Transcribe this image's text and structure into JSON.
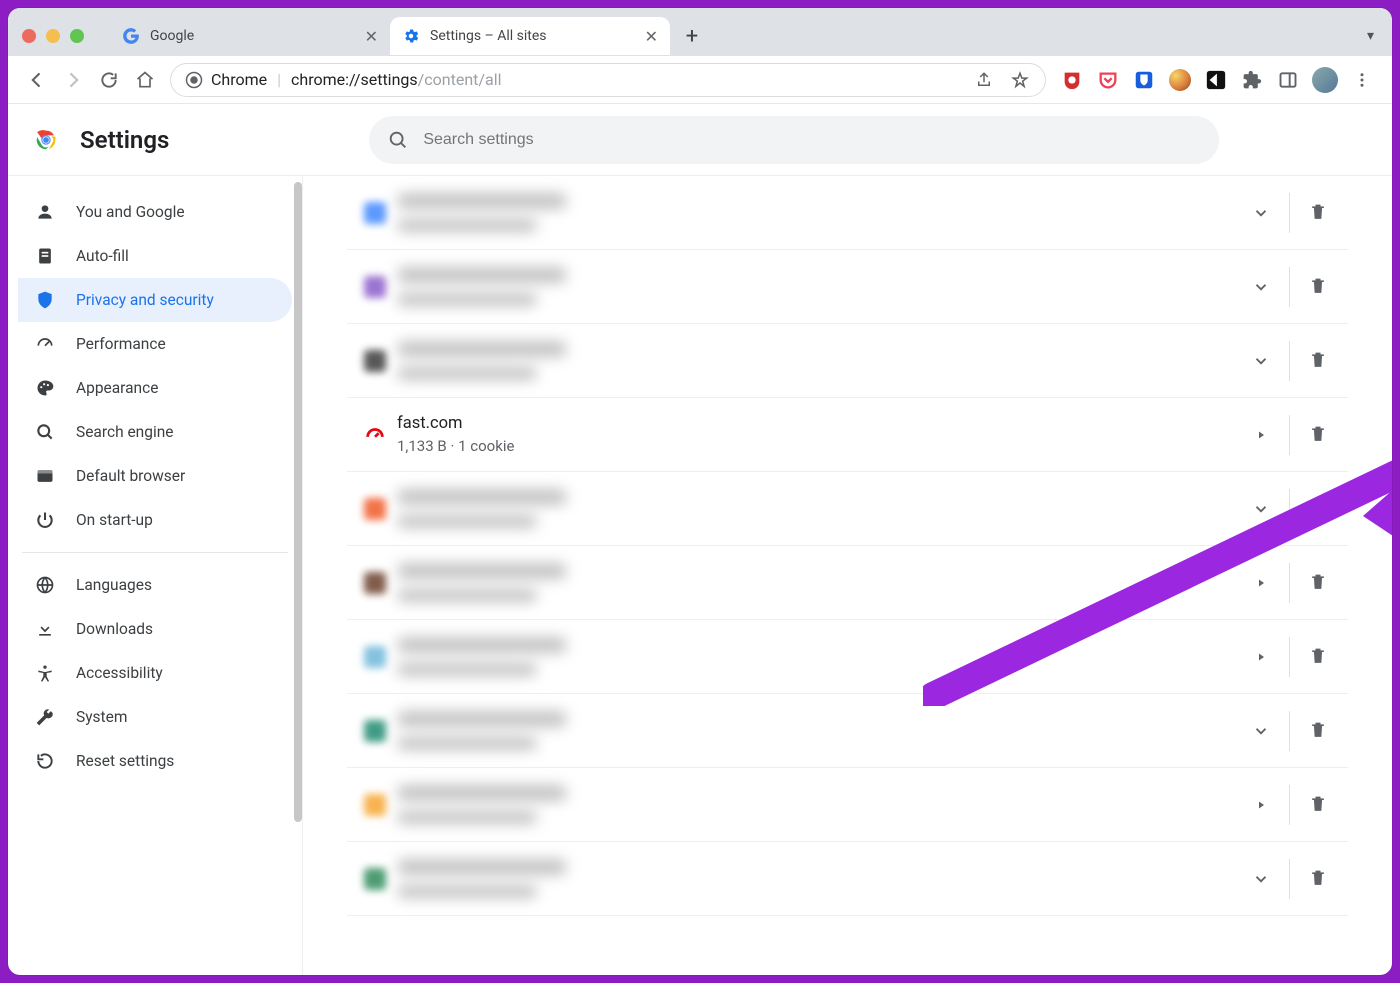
{
  "window": {
    "tabs": [
      {
        "title": "Google",
        "active": false
      },
      {
        "title": "Settings – All sites",
        "active": true
      }
    ]
  },
  "toolbar": {
    "secure_label": "Chrome",
    "url_prefix": "chrome://settings",
    "url_suffix": "/content/all"
  },
  "header": {
    "title": "Settings",
    "search_placeholder": "Search settings"
  },
  "sidebar": {
    "items": [
      {
        "label": "You and Google",
        "icon": "person"
      },
      {
        "label": "Auto-fill",
        "icon": "autofill"
      },
      {
        "label": "Privacy and security",
        "icon": "shield",
        "active": true
      },
      {
        "label": "Performance",
        "icon": "speed"
      },
      {
        "label": "Appearance",
        "icon": "palette"
      },
      {
        "label": "Search engine",
        "icon": "search"
      },
      {
        "label": "Default browser",
        "icon": "browser"
      },
      {
        "label": "On start-up",
        "icon": "power"
      }
    ],
    "items2": [
      {
        "label": "Languages",
        "icon": "globe"
      },
      {
        "label": "Downloads",
        "icon": "download"
      },
      {
        "label": "Accessibility",
        "icon": "a11y"
      },
      {
        "label": "System",
        "icon": "wrench"
      },
      {
        "label": "Reset settings",
        "icon": "reset"
      }
    ]
  },
  "sites": [
    {
      "blurred": true,
      "favcolor": "#3f87ff",
      "expand": "chevron"
    },
    {
      "blurred": true,
      "favcolor": "#8a5cc9",
      "expand": "chevron"
    },
    {
      "blurred": true,
      "favcolor": "#3a3a3a",
      "expand": "chevron"
    },
    {
      "blurred": false,
      "title": "fast.com",
      "sub": "1,133 B · 1 cookie",
      "favcolor": "#e50914",
      "favtype": "fast",
      "expand": "caret"
    },
    {
      "blurred": true,
      "favcolor": "#f15a29",
      "expand": "chevron"
    },
    {
      "blurred": true,
      "favcolor": "#6b3f2a",
      "expand": "caret"
    },
    {
      "blurred": true,
      "favcolor": "#6fb7d9",
      "expand": "caret"
    },
    {
      "blurred": true,
      "favcolor": "#1f8a70",
      "expand": "chevron"
    },
    {
      "blurred": true,
      "favcolor": "#f7a531",
      "expand": "caret"
    },
    {
      "blurred": true,
      "favcolor": "#2f8b5b",
      "expand": "chevron"
    }
  ],
  "annotation": {
    "color": "#9c27e0",
    "target_row_index": 3
  }
}
